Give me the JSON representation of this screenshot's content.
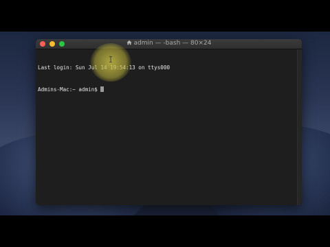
{
  "window": {
    "title": "admin — -bash — 80×24"
  },
  "terminal": {
    "lines": [
      "Last login: Sun Jul 14 19:54:13 on ttys000",
      "Admins-Mac:~ admin$ "
    ]
  },
  "colors": {
    "close": "#ff5f57",
    "minimize": "#febc2e",
    "maximize": "#28c840",
    "terminal_bg": "#1e1e1e",
    "text": "#e8e8e8"
  },
  "icons": [
    "home-icon",
    "close-icon",
    "minimize-icon",
    "maximize-icon",
    "ibeam-cursor-icon"
  ]
}
